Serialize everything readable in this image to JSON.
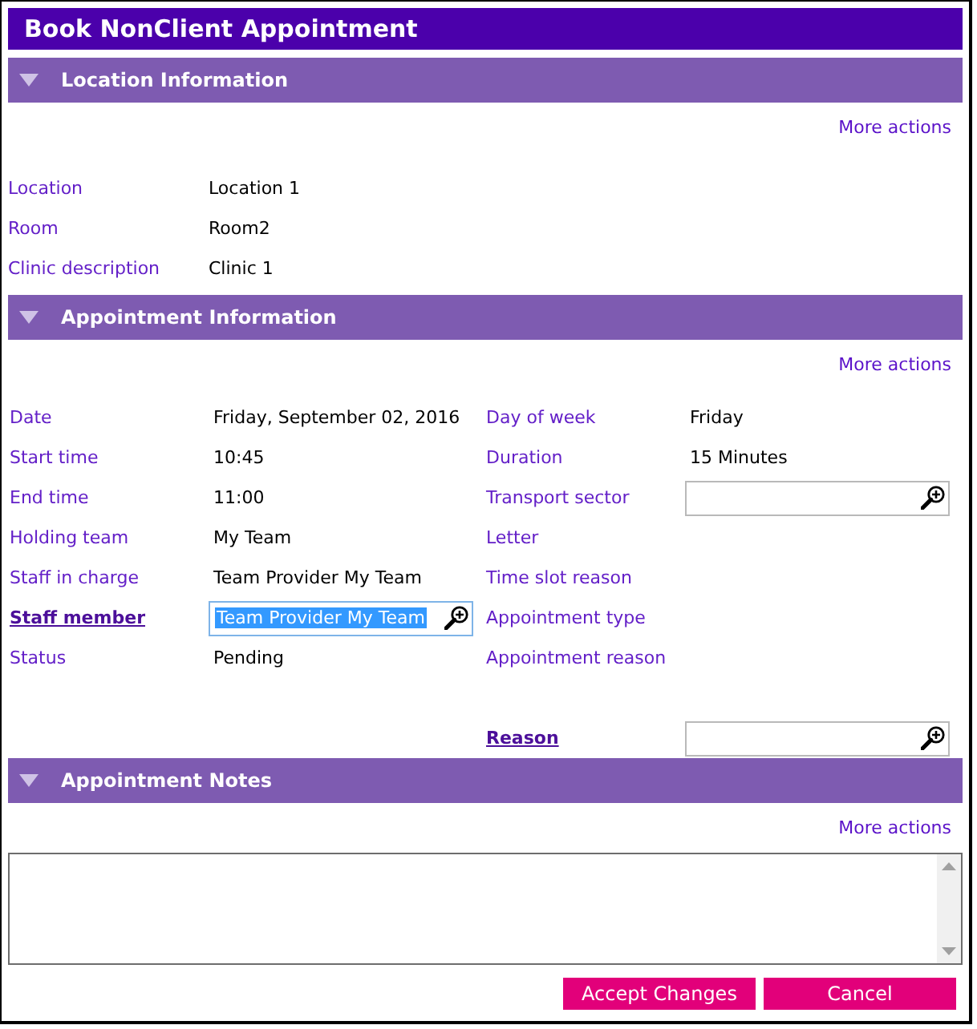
{
  "window": {
    "title": "Book NonClient Appointment"
  },
  "sections": [
    {
      "kind": "list",
      "title": "Location Information",
      "expanded": true,
      "more_actions": "More actions",
      "fields": [
        {
          "label": "Location",
          "link": false,
          "kind": "text",
          "value": "Location 1"
        },
        {
          "label": "Room",
          "link": false,
          "kind": "text",
          "value": "Room2"
        },
        {
          "label": "Clinic description",
          "link": false,
          "kind": "text",
          "value": "Clinic 1"
        }
      ]
    },
    {
      "kind": "grid",
      "title": "Appointment Information",
      "expanded": true,
      "more_actions": "More actions",
      "rows": [
        {
          "left": {
            "label": "Date",
            "link": false,
            "kind": "text",
            "value": "Friday, September 02, 2016"
          },
          "right": {
            "label": "Day of week",
            "link": false,
            "kind": "text",
            "value": "Friday"
          }
        },
        {
          "left": {
            "label": "Start time",
            "link": false,
            "kind": "text",
            "value": "10:45"
          },
          "right": {
            "label": "Duration",
            "link": false,
            "kind": "text",
            "value": "15 Minutes"
          }
        },
        {
          "left": {
            "label": "End time",
            "link": false,
            "kind": "text",
            "value": "11:00"
          },
          "right": {
            "label": "Transport sector",
            "link": false,
            "kind": "lookup",
            "text_selected": false
          }
        },
        {
          "left": {
            "label": "Holding team",
            "link": false,
            "kind": "text",
            "value": "My Team"
          },
          "right": {
            "label": "Letter",
            "link": false,
            "kind": "text"
          }
        },
        {
          "left": {
            "label": "Staff in charge",
            "link": false,
            "kind": "text",
            "value": "Team Provider My Team"
          },
          "right": {
            "label": "Time slot reason",
            "link": false,
            "kind": "text"
          }
        },
        {
          "left": {
            "label": "Staff member",
            "link": true,
            "kind": "lookup",
            "value": "Team Provider My Team",
            "text_selected": true
          },
          "right": {
            "label": "Appointment type",
            "link": false,
            "kind": "text"
          }
        },
        {
          "left": {
            "label": "Status",
            "link": false,
            "kind": "text",
            "value": "Pending"
          },
          "right": {
            "label": "Appointment reason",
            "link": false,
            "kind": "text"
          }
        },
        {},
        {
          "right": {
            "label": "Reason",
            "link": true,
            "kind": "lookup",
            "text_selected": false
          }
        }
      ]
    },
    {
      "kind": "notes",
      "title": "Appointment Notes",
      "expanded": true,
      "more_actions": "More actions"
    }
  ],
  "buttons": [
    "Accept Changes",
    "Cancel"
  ]
}
